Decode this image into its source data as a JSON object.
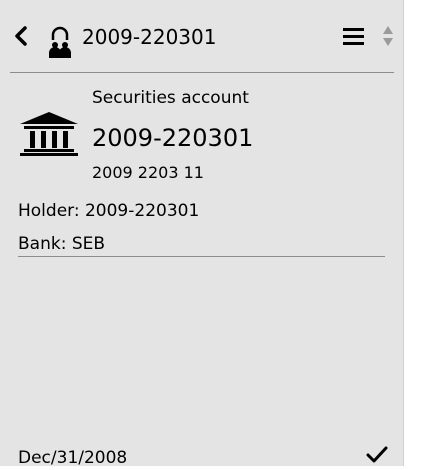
{
  "header": {
    "title": "2009-220301",
    "back_icon": "chevron-left-icon",
    "account_icon": "lock-people-icon",
    "menu_icon": "hamburger-menu-icon",
    "sort_icon": "sort-arrows-icon"
  },
  "account": {
    "type": "Securities account",
    "name": "2009-220301",
    "number": "2009 2203 11",
    "holder": "Holder: 2009-220301",
    "bank": "Bank: SEB",
    "icon": "bank-building-icon"
  },
  "footer": {
    "date": "Dec/31/2008",
    "status_icon": "checkmark-icon"
  },
  "colors": {
    "panel_bg": "#e4e4e4",
    "text": "#000000",
    "divider": "#8c8c8c",
    "sort_arrows": "#9a9a9a"
  }
}
